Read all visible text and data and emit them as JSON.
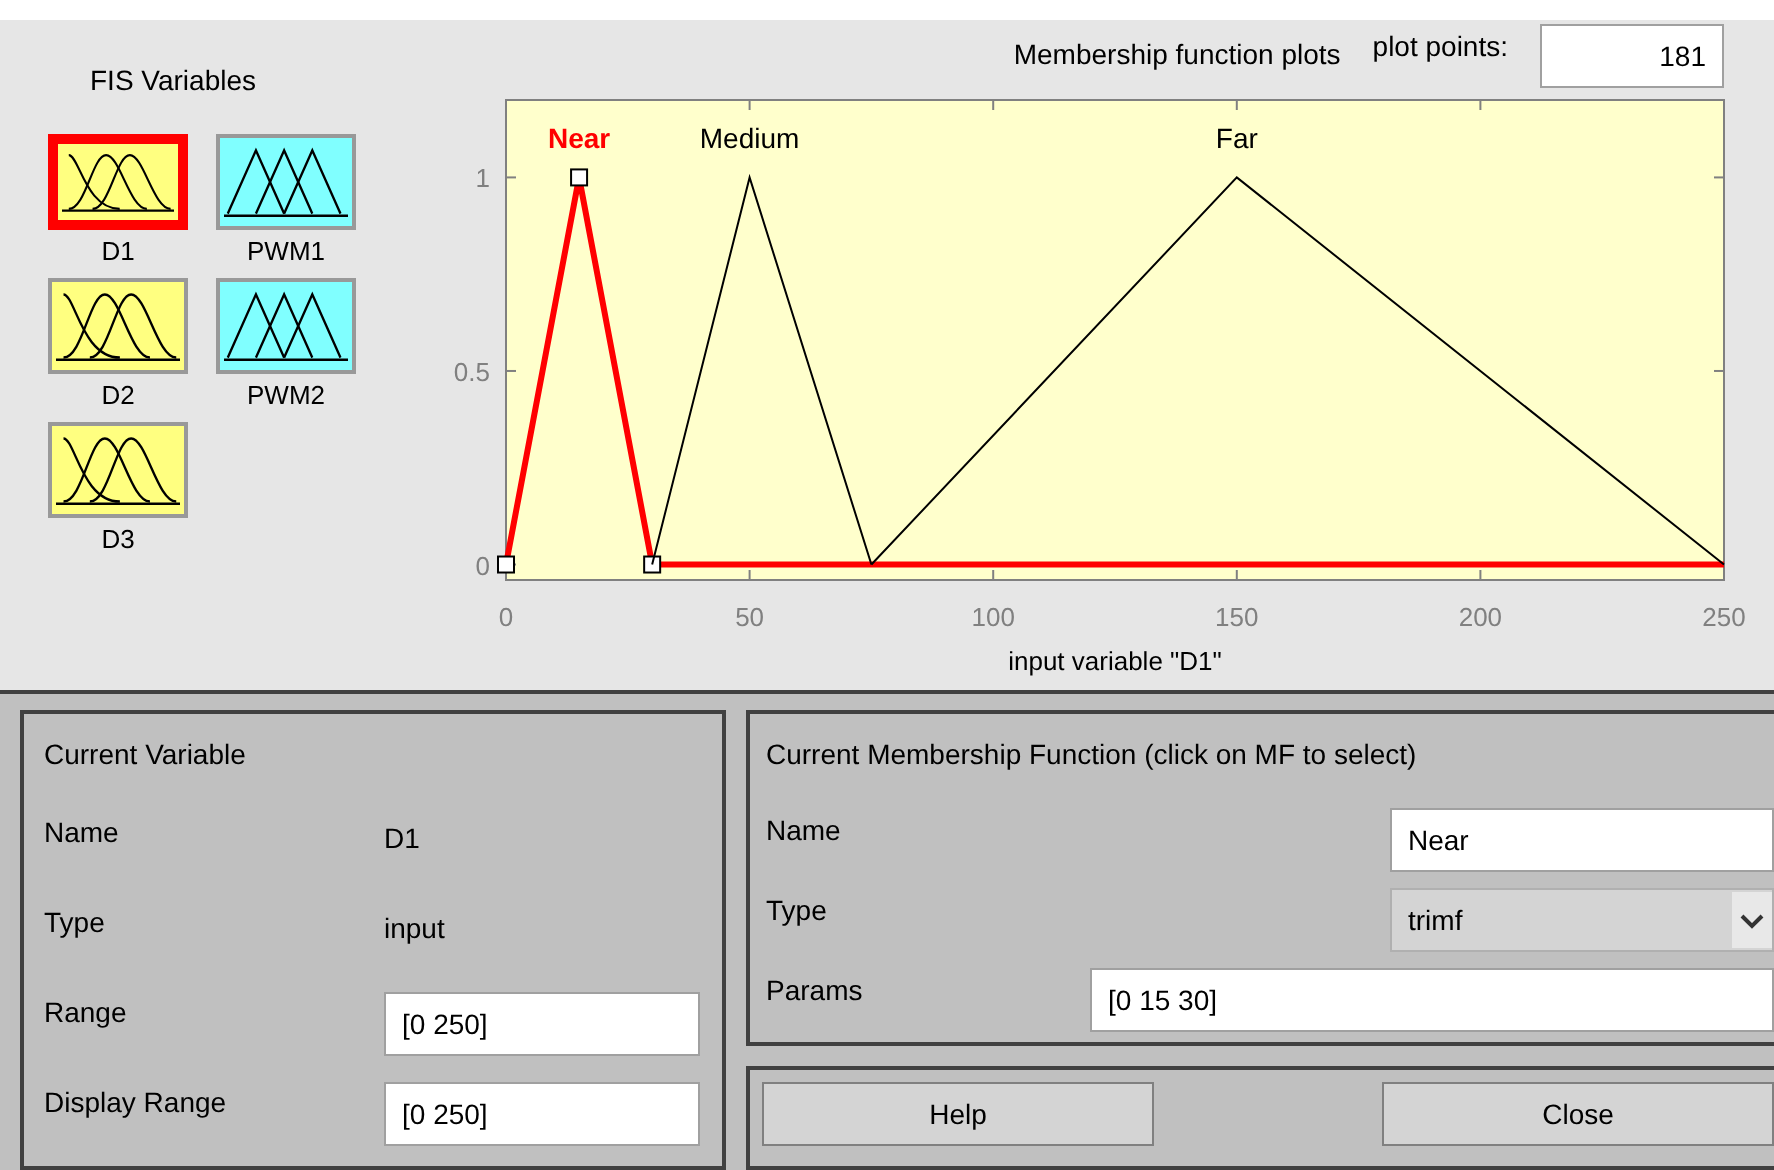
{
  "fis_variables": {
    "title": "FIS Variables",
    "inputs": [
      {
        "name": "D1",
        "selected": true
      },
      {
        "name": "D2",
        "selected": false
      },
      {
        "name": "D3",
        "selected": false
      }
    ],
    "outputs": [
      {
        "name": "PWM1",
        "selected": false
      },
      {
        "name": "PWM2",
        "selected": false
      }
    ]
  },
  "plot_header": {
    "title": "Membership function plots",
    "plot_points_label": "plot points:",
    "plot_points": "181"
  },
  "chart_data": {
    "type": "line",
    "xlabel": "input variable \"D1\"",
    "x": [
      0,
      15,
      30,
      50,
      75,
      150,
      250
    ],
    "series": [
      {
        "color": "#ff0000",
        "values": [
          0,
          1,
          0,
          0,
          0,
          0,
          0
        ]
      },
      {
        "color": "#000000",
        "values": [
          null,
          null,
          0,
          1,
          0,
          null,
          null
        ]
      },
      {
        "color": "#000000",
        "values": [
          null,
          null,
          null,
          null,
          0,
          1,
          0
        ]
      }
    ],
    "annotations": [
      "Near",
      "Medium",
      "Far"
    ],
    "xlim": [
      0,
      250
    ],
    "ylim": [
      -0.04,
      1.2
    ],
    "xticks": [
      0,
      50,
      100,
      150,
      200,
      250
    ],
    "yticks": [
      0,
      0.5,
      1
    ]
  },
  "membership_functions": [
    {
      "selected": true
    },
    {
      "selected": false
    },
    {
      "selected": false
    }
  ],
  "current_variable": {
    "title": "Current Variable",
    "rows": [
      {
        "kind": "text",
        "label": "Name",
        "value": "D1"
      },
      {
        "kind": "text",
        "label": "Type",
        "value": "input"
      },
      {
        "kind": "field",
        "label": "Range",
        "value": "[0 250]"
      },
      {
        "kind": "field",
        "label": "Display Range",
        "value": "[0 250]"
      }
    ]
  },
  "current_mf": {
    "title": "Current Membership Function (click on MF to select)",
    "name_label": "Name",
    "name": "Near",
    "type_label": "Type",
    "type": "trimf",
    "params_label": "Params",
    "params": "[0 15 30]"
  },
  "buttons": [
    "Help",
    "Close"
  ]
}
